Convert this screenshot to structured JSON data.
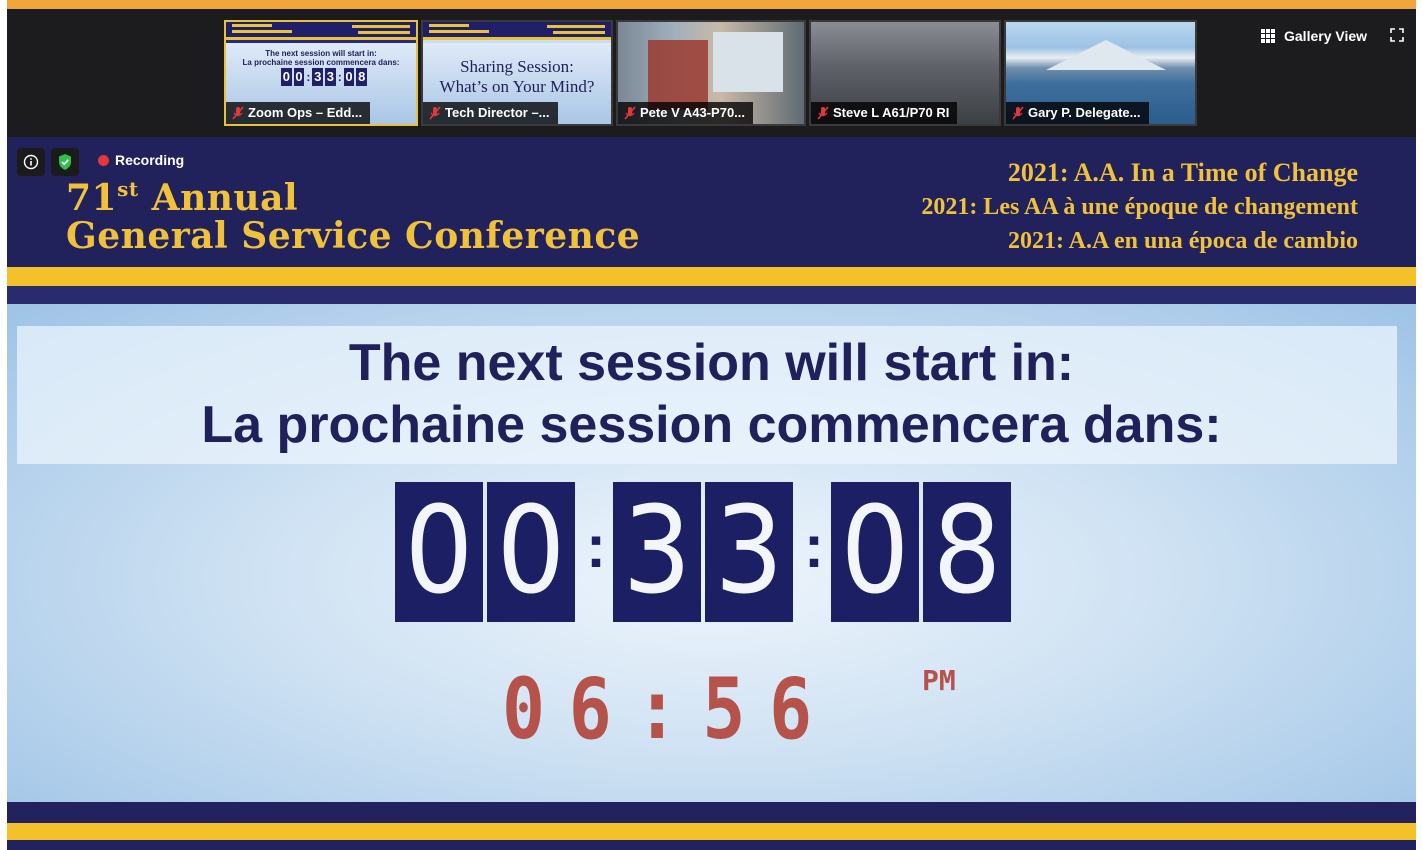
{
  "participants": [
    {
      "name": "Zoom Ops – Edd...",
      "muted": true
    },
    {
      "name": "Tech Director –...",
      "muted": true
    },
    {
      "name": "Pete V A43-P70...",
      "muted": true
    },
    {
      "name": "Steve L A61/P70 RI",
      "muted": true
    },
    {
      "name": "Gary P.  Delegate...",
      "muted": true
    }
  ],
  "thumb1": {
    "line1": "The next session will start in:",
    "line2": "La prochaine session commencera dans:",
    "digits": [
      "0",
      "0",
      "3",
      "3",
      "0",
      "8"
    ]
  },
  "thumb2": {
    "line1": "Sharing Session:",
    "line2": "What’s on Your Mind?"
  },
  "top_bar": {
    "gallery_view_label": "Gallery View",
    "icons": [
      "grid-icon",
      "fullscreen-icon"
    ]
  },
  "status": {
    "recording_label": "Recording",
    "icons": [
      "info-icon",
      "shield-check-icon"
    ]
  },
  "banner": {
    "ordinal": "71",
    "ordinal_suffix": "st",
    "line1_rest": "Annual",
    "line2": "General Service Conference",
    "theme_en": "2021: A.A. In a Time of Change",
    "theme_fr": "2021: Les AA à une époque de changement",
    "theme_es": "2021: A.A en una época de cambio"
  },
  "countdown": {
    "heading_en": "The next session will start in:",
    "heading_fr": "La prochaine session commencera dans:",
    "digits": [
      "0",
      "0",
      "3",
      "3",
      "0",
      "8"
    ],
    "separator": ":"
  },
  "start_time": {
    "time": "06:56",
    "meridiem": "PM"
  },
  "colors": {
    "navy": "#21215c",
    "gold": "#f0c23b",
    "clock_red": "#b03a2e",
    "recording_red": "#e2383c"
  }
}
